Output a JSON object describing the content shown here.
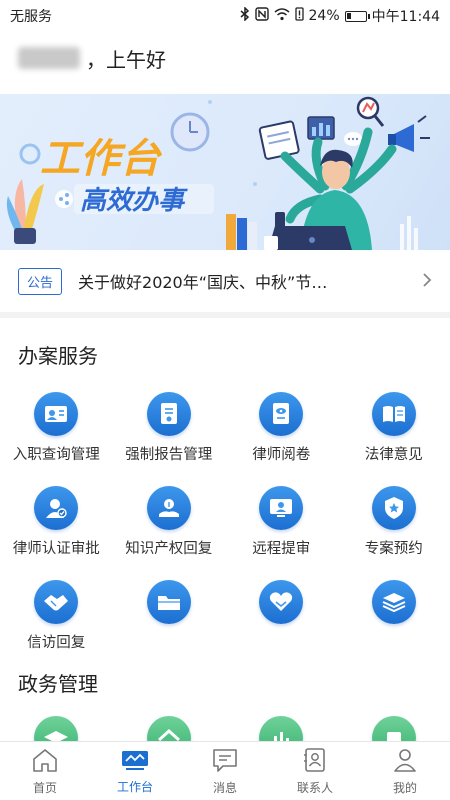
{
  "status_bar": {
    "carrier": "无服务",
    "battery": "24%",
    "battery_level": 0.24,
    "time": "中午11:44",
    "icons": [
      "bluetooth-icon",
      "nfc-icon",
      "wifi-icon",
      "alert-icon",
      "battery-icon"
    ]
  },
  "greeting": {
    "suffix": "，上午好"
  },
  "banner": {
    "title": "工作台",
    "subtitle": "高效办事"
  },
  "notice": {
    "tag": "公告",
    "text": "关于做好2020年“国庆、中秋”节…"
  },
  "section_case": {
    "title": "办案服务",
    "items": [
      {
        "label": "入职查询管理",
        "icon": "id-card-icon"
      },
      {
        "label": "强制报告管理",
        "icon": "report-document-icon"
      },
      {
        "label": "律师阅卷",
        "icon": "eye-document-icon"
      },
      {
        "label": "法律意见",
        "icon": "open-book-icon"
      },
      {
        "label": "律师认证审批",
        "icon": "user-check-icon"
      },
      {
        "label": "知识产权回复",
        "icon": "hand-bulb-icon"
      },
      {
        "label": "远程提审",
        "icon": "video-monitor-icon"
      },
      {
        "label": "专案预约",
        "icon": "star-shield-icon"
      },
      {
        "label": "信访回复",
        "icon": "handshake-icon"
      },
      {
        "label": "",
        "icon": "folder-icon"
      },
      {
        "label": "",
        "icon": "heart-hands-icon"
      },
      {
        "label": "",
        "icon": "layers-icon"
      }
    ]
  },
  "section_gov": {
    "title": "政务管理",
    "items": [
      {
        "icon": "graduation-cap-icon"
      },
      {
        "icon": "home-icon"
      },
      {
        "icon": "bar-chart-icon"
      },
      {
        "icon": "document-icon"
      }
    ]
  },
  "tabbar": {
    "tabs": [
      {
        "label": "首页",
        "icon": "home-tab-icon",
        "active": false
      },
      {
        "label": "工作台",
        "icon": "workbench-tab-icon",
        "active": true
      },
      {
        "label": "消息",
        "icon": "message-tab-icon",
        "active": false
      },
      {
        "label": "联系人",
        "icon": "contacts-tab-icon",
        "active": false
      },
      {
        "label": "我的",
        "icon": "profile-tab-icon",
        "active": false
      }
    ]
  },
  "colors": {
    "primary": "#1c6fd1",
    "icon_blue": "#3d97ec",
    "icon_green": "#38b06d",
    "banner_title": "#f5a623"
  }
}
